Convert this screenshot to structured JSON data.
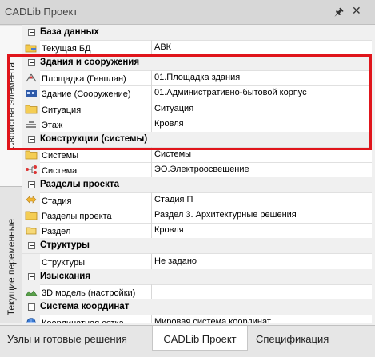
{
  "window": {
    "title": "CADLib Проект",
    "pin_icon": "pin-icon",
    "close_icon": "close-icon"
  },
  "side_tabs": [
    {
      "label": "Свойства элемента",
      "active": true
    },
    {
      "label": "Текущие переменные",
      "active": false
    }
  ],
  "categories": [
    {
      "label": "База данных",
      "rows": [
        {
          "name": "Текущая БД",
          "value": "АВК",
          "icon": "folder-database-icon"
        }
      ]
    },
    {
      "label": "Здания и сооружения",
      "rows": [
        {
          "name": "Площадка (Генплан)",
          "value": "01.Площадка здания",
          "icon": "site-plan-icon"
        },
        {
          "name": "Здание (Сооружение)",
          "value": "01.Административно-бытовой корпус",
          "icon": "building-icon"
        },
        {
          "name": "Ситуация",
          "value": "Ситуация",
          "icon": "folder-icon"
        },
        {
          "name": "Этаж",
          "value": "Кровля",
          "icon": "floor-icon"
        }
      ]
    },
    {
      "label": "Конструкции (системы)",
      "rows": [
        {
          "name": "Системы",
          "value": "Системы",
          "icon": "folder-icon"
        },
        {
          "name": "Система",
          "value": "ЭО.Электроосвещение",
          "icon": "system-icon"
        }
      ]
    },
    {
      "label": "Разделы проекта",
      "rows": [
        {
          "name": "Стадия",
          "value": "Стадия П",
          "icon": "stage-icon"
        },
        {
          "name": "Разделы проекта",
          "value": "Раздел 3. Архитектурные решения",
          "icon": "folder-icon"
        },
        {
          "name": "Раздел",
          "value": "Кровля",
          "icon": "section-icon"
        }
      ]
    },
    {
      "label": "Структуры",
      "rows": [
        {
          "name": "Структуры",
          "value": "Не задано",
          "icon": ""
        }
      ]
    },
    {
      "label": "Изыскания",
      "rows": [
        {
          "name": "3D модель (настройки)",
          "value": "",
          "icon": "terrain-icon"
        }
      ]
    },
    {
      "label": "Система координат",
      "rows": [
        {
          "name": "Координатная сетка",
          "value": "Мировая система координат",
          "icon": "globe-icon"
        }
      ]
    }
  ],
  "bottom_tabs": [
    {
      "label": "Узлы и готовые решения",
      "active": false
    },
    {
      "label": "CADLib Проект",
      "active": true
    },
    {
      "label": "Спецификация",
      "active": false
    }
  ],
  "colors": {
    "highlight": "#e0151b",
    "category_bg": "#f0f0f0",
    "accent": "#1f5fbf"
  }
}
